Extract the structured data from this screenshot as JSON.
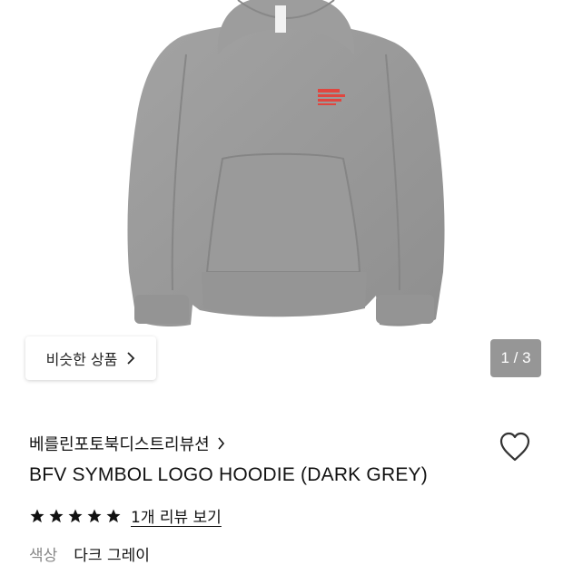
{
  "gallery": {
    "counter": "1 / 3",
    "similar_button_label": "비슷한 상품",
    "similar_button_icon": "chevron-right-icon",
    "logo_print_color": "#e0463f",
    "hoodie_color": "#9a9a9a"
  },
  "product": {
    "brand": "베를린포토북디스트리뷰션",
    "brand_icon": "chevron-right-icon",
    "title": "BFV SYMBOL LOGO HOODIE (DARK GREY)",
    "wishlist_icon": "heart-outline-icon",
    "rating": {
      "stars": 5,
      "max": 5,
      "star_color": "#111111"
    },
    "review_link": "1개 리뷰 보기",
    "color_label": "색상",
    "color_value": "다크 그레이"
  }
}
